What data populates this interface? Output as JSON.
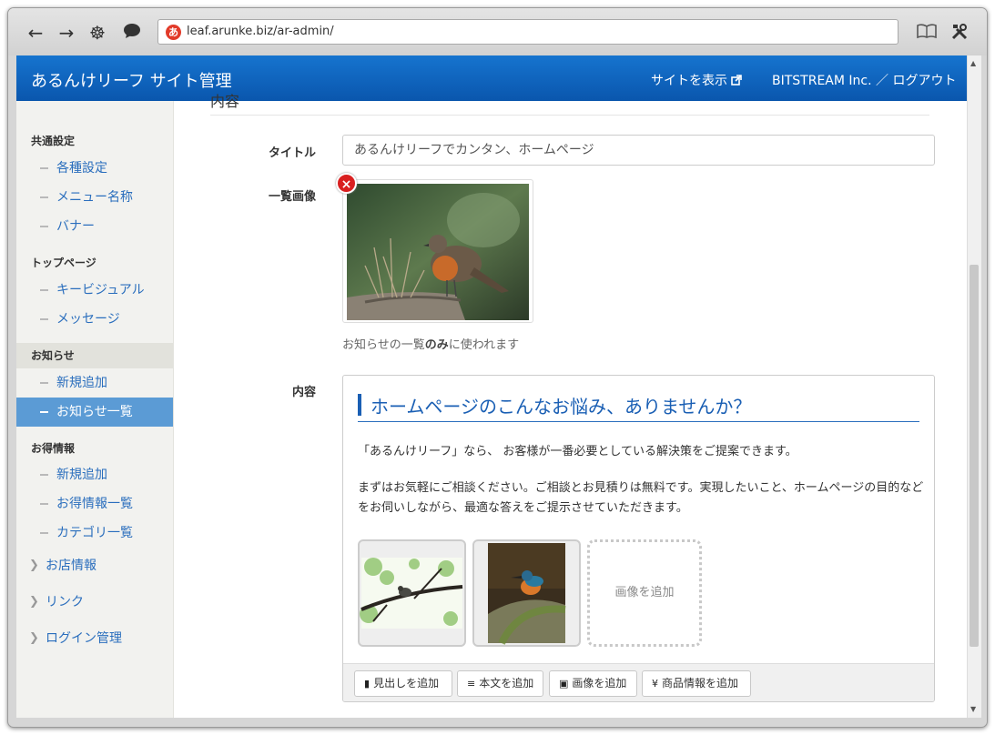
{
  "browser": {
    "url": "leaf.arunke.biz/ar-admin/",
    "favicon_text": "あ"
  },
  "header": {
    "title": "あるんけリーフ サイト管理",
    "view_site": "サイトを表示",
    "user_logout": "BITSTREAM Inc. ／ ログアウト"
  },
  "sidebar": {
    "sections": [
      {
        "label": "共通設定",
        "items": [
          "各種設定",
          "メニュー名称",
          "バナー"
        ]
      },
      {
        "label": "トップページ",
        "items": [
          "キービジュアル",
          "メッセージ"
        ]
      },
      {
        "label": "お知らせ",
        "items": [
          "新規追加",
          "お知らせ一覧"
        ]
      },
      {
        "label": "お得情報",
        "items": [
          "新規追加",
          "お得情報一覧",
          "カテゴリ一覧"
        ]
      }
    ],
    "groups": [
      "お店情報",
      "リンク",
      "ログイン管理"
    ]
  },
  "form": {
    "partial_heading": "内容",
    "title_label": "タイトル",
    "title_value": "あるんけリーフでカンタン、ホームページ",
    "image_label": "一覧画像",
    "image_help_pre": "お知らせの一覧",
    "image_help_bold": "のみ",
    "image_help_post": "に使われます",
    "content_label": "内容",
    "delete_symbol": "×"
  },
  "editor": {
    "heading": "ホームページのこんなお悩み、ありませんか？",
    "para1": "「あるんけリーフ」なら、 お客様が一番必要としている解決策をご提案できます。",
    "para2": "まずはお気軽にご相談ください。ご相談とお見積りは無料です。実現したいこと、ホームページの目的などをお伺いしながら、最適な答えをご提示させていただきます。",
    "add_image_tile": "画像を追加",
    "toolbar": {
      "add_heading": "見出しを追加",
      "add_text": "本文を追加",
      "add_image": "画像を追加",
      "add_product": "商品情報を追加"
    }
  }
}
